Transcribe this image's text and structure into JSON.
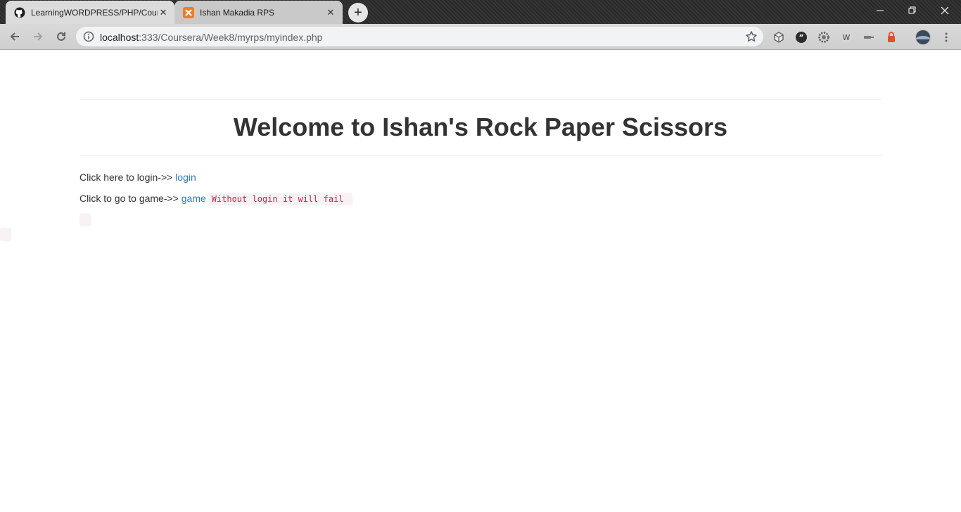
{
  "browser": {
    "tabs": [
      {
        "title": "LearningWORDPRESS/PHP/Coursera",
        "active": true
      },
      {
        "title": "Ishan Makadia RPS",
        "active": false
      }
    ],
    "address": {
      "host": "localhost",
      "path": ":333/Coursera/Week8/myrps/myindex.php"
    }
  },
  "page": {
    "title": "Welcome to Ishan's Rock Paper Scissors",
    "login_line": {
      "prefix": "Click here to login->> ",
      "link": "login"
    },
    "game_line": {
      "prefix": "Click to go to game->> ",
      "link": "game",
      "note": "Without login it will fail"
    }
  },
  "colors": {
    "link": "#337ab7",
    "code_text": "#c7254e",
    "code_bg": "#f9f2f4",
    "heading": "#333333"
  }
}
